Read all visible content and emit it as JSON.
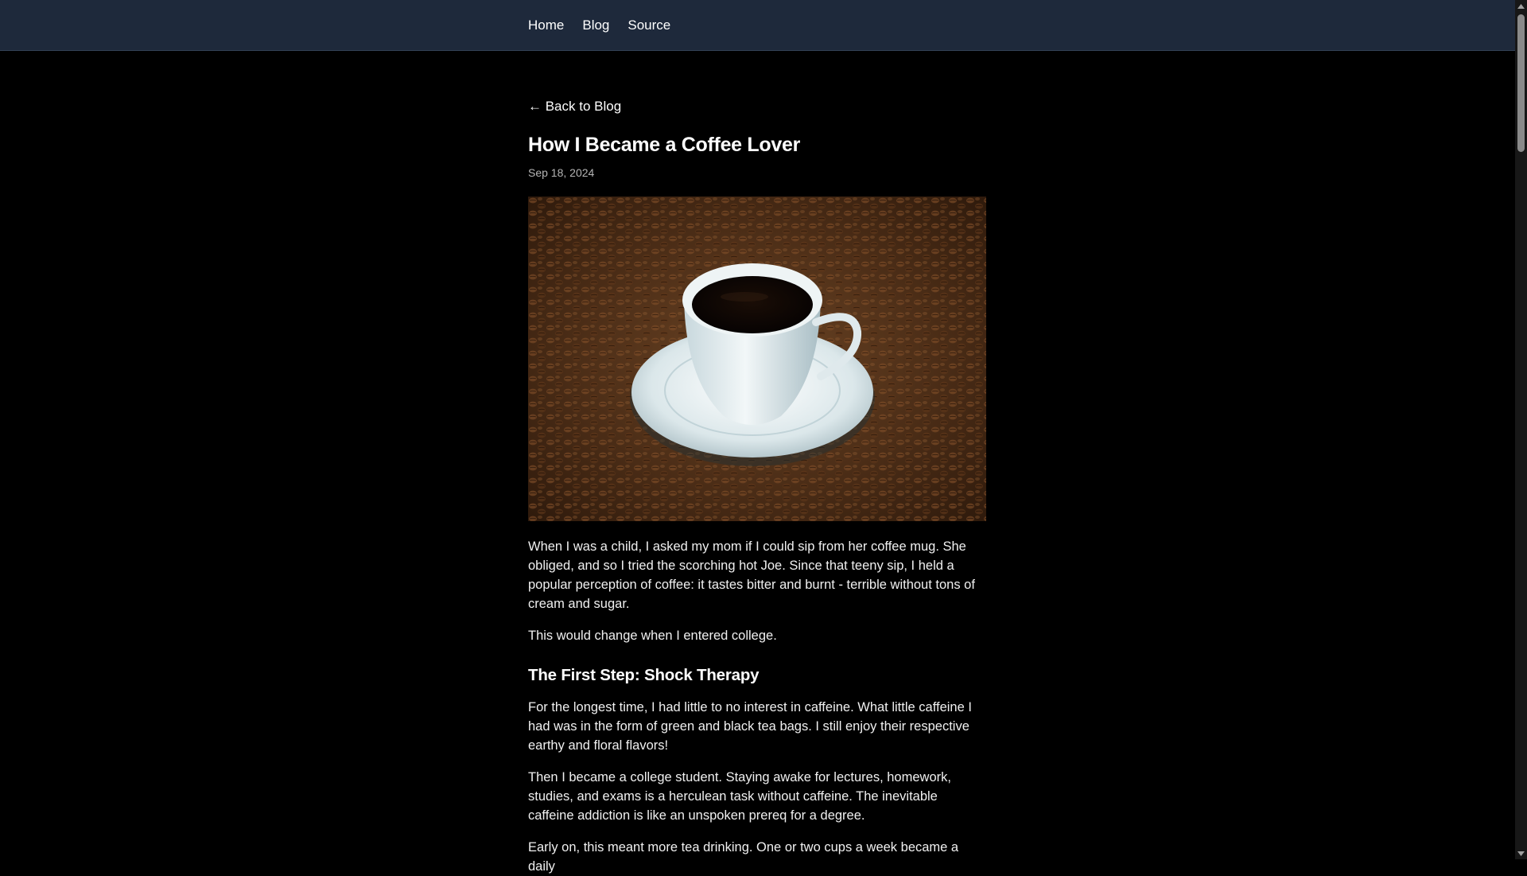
{
  "nav": {
    "items": [
      {
        "label": "Home"
      },
      {
        "label": "Blog"
      },
      {
        "label": "Source"
      }
    ]
  },
  "post": {
    "back_label": "← Back to Blog",
    "title": "How I Became a Coffee Lover",
    "date": "Sep 18, 2024",
    "image_description": "cup of black coffee on a saucer atop coffee beans",
    "paragraphs_intro": [
      "When I was a child, I asked my mom if I could sip from her coffee mug. She obliged, and so I tried the scorching hot Joe. Since that teeny sip, I held a popular perception of coffee: it tastes bitter and burnt - terrible without tons of cream and sugar.",
      "This would change when I entered college."
    ],
    "section1": {
      "heading": "The First Step: Shock Therapy",
      "paragraphs": [
        "For the longest time, I had little to no interest in caffeine. What little caffeine I had was in the form of green and black tea bags. I still enjoy their respective earthy and floral flavors!",
        "Then I became a college student. Staying awake for lectures, homework, studies, and exams is a herculean task without caffeine. The inevitable caffeine addiction is like an unspoken prereq for a degree.",
        "Early on, this meant more tea drinking. One or two cups a week became a daily"
      ]
    }
  },
  "colors": {
    "topbar": "#1e293b",
    "background": "#000000",
    "text": "#f0f0f0",
    "muted": "#b5b5b5"
  }
}
